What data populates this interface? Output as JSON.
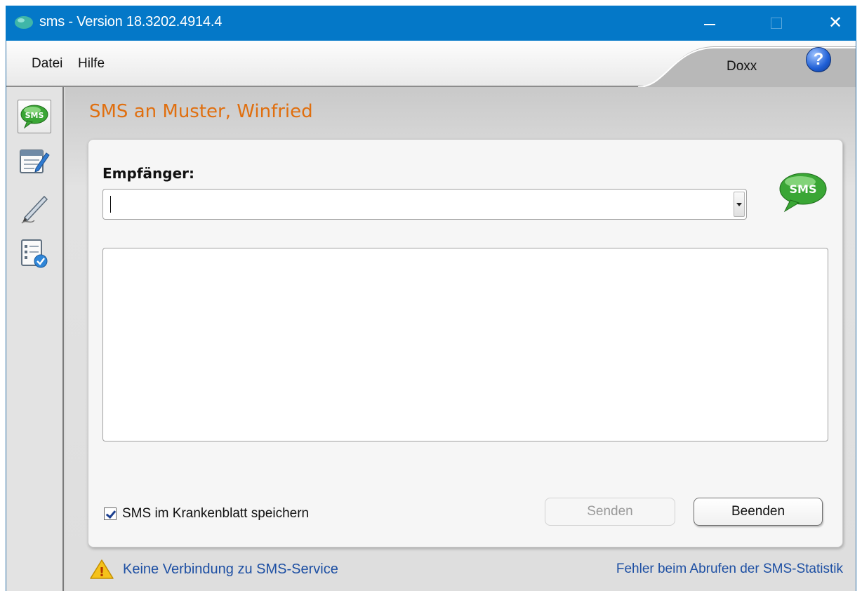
{
  "window": {
    "title": "sms - Version 18.3202.4914.4",
    "close_glyph": "✕",
    "accent_color": "#0478c8"
  },
  "menu": {
    "items": [
      {
        "label": "Datei"
      },
      {
        "label": "Hilfe"
      }
    ],
    "user_name": "Doxx",
    "help_glyph": "?"
  },
  "sidebar": {
    "items": [
      {
        "icon": "sms-bubble-icon",
        "active": true
      },
      {
        "icon": "edit-form-icon",
        "active": false
      },
      {
        "icon": "pen-signature-icon",
        "active": false
      },
      {
        "icon": "checklist-icon",
        "active": false
      }
    ]
  },
  "page": {
    "title": "SMS an Muster, Winfried",
    "title_color": "#e06f0f"
  },
  "form": {
    "recipient_label": "Empfänger:",
    "recipient_value": "",
    "message_value": "",
    "badge_text": "SMS",
    "save_checkbox_label": "SMS im Krankenblatt speichern",
    "save_checkbox_checked": true,
    "send_label": "Senden",
    "send_enabled": false,
    "close_label": "Beenden"
  },
  "status": {
    "warning_glyph": "!",
    "left_text": "Keine Verbindung zu SMS-Service",
    "right_text": "Fehler beim Abrufen der SMS-Statistik",
    "link_color": "#1d4fa3"
  }
}
